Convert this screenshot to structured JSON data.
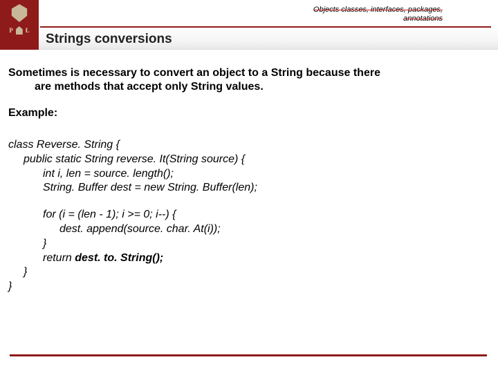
{
  "header": {
    "breadcrumb_line1": "Objects classes, interfaces, packages,",
    "breadcrumb_line2": "annotations",
    "title": "Strings conversions",
    "logo_left": "P",
    "logo_right": "Ł"
  },
  "body": {
    "intro_l1": "Sometimes is necessary to convert an object to a String because there",
    "intro_l2": "are methods that accept only String values.",
    "example_label": "Example:",
    "code": {
      "l1": "class Reverse. String {",
      "l2": "public static String reverse. It(String source) {",
      "l3": "int i, len = source. length();",
      "l4": "String. Buffer dest = new String. Buffer(len);",
      "l5": "for (i = (len - 1); i >= 0; i--) {",
      "l6": "dest. append(source. char. At(i));",
      "l7": "}",
      "l8a": "return ",
      "l8b": "dest. to. String();",
      "l9": "}",
      "l10": "}"
    }
  }
}
